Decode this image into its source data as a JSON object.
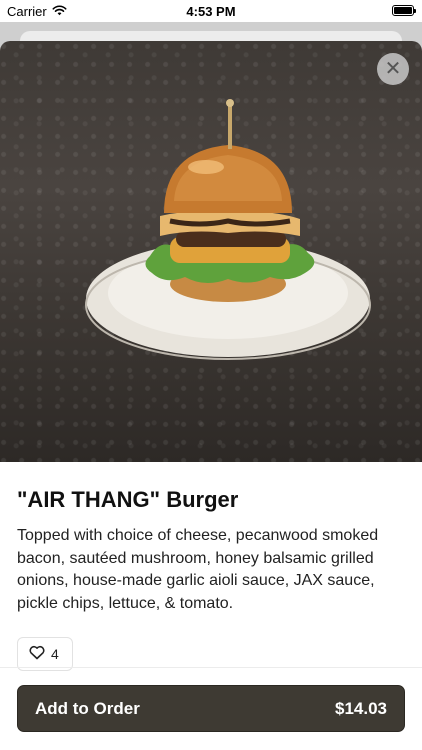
{
  "status_bar": {
    "carrier": "Carrier",
    "time": "4:53 PM"
  },
  "item": {
    "title": "\"AIR THANG\" Burger",
    "description": "Topped with choice of cheese, pecanwood smoked bacon, sautéed mushroom, honey balsamic grilled onions, house-made garlic aioli sauce, JAX sauce, pickle chips, lettuce, & tomato.",
    "image_alt": "burger-photo",
    "likes": "4"
  },
  "actions": {
    "add_label": "Add to Order",
    "price": "$14.03"
  },
  "icons": {
    "close": "close-icon",
    "like": "heart-icon",
    "wifi": "wifi-icon",
    "battery": "battery-icon"
  },
  "colors": {
    "button_bg": "#3e3a33",
    "button_text": "#ffffff"
  }
}
